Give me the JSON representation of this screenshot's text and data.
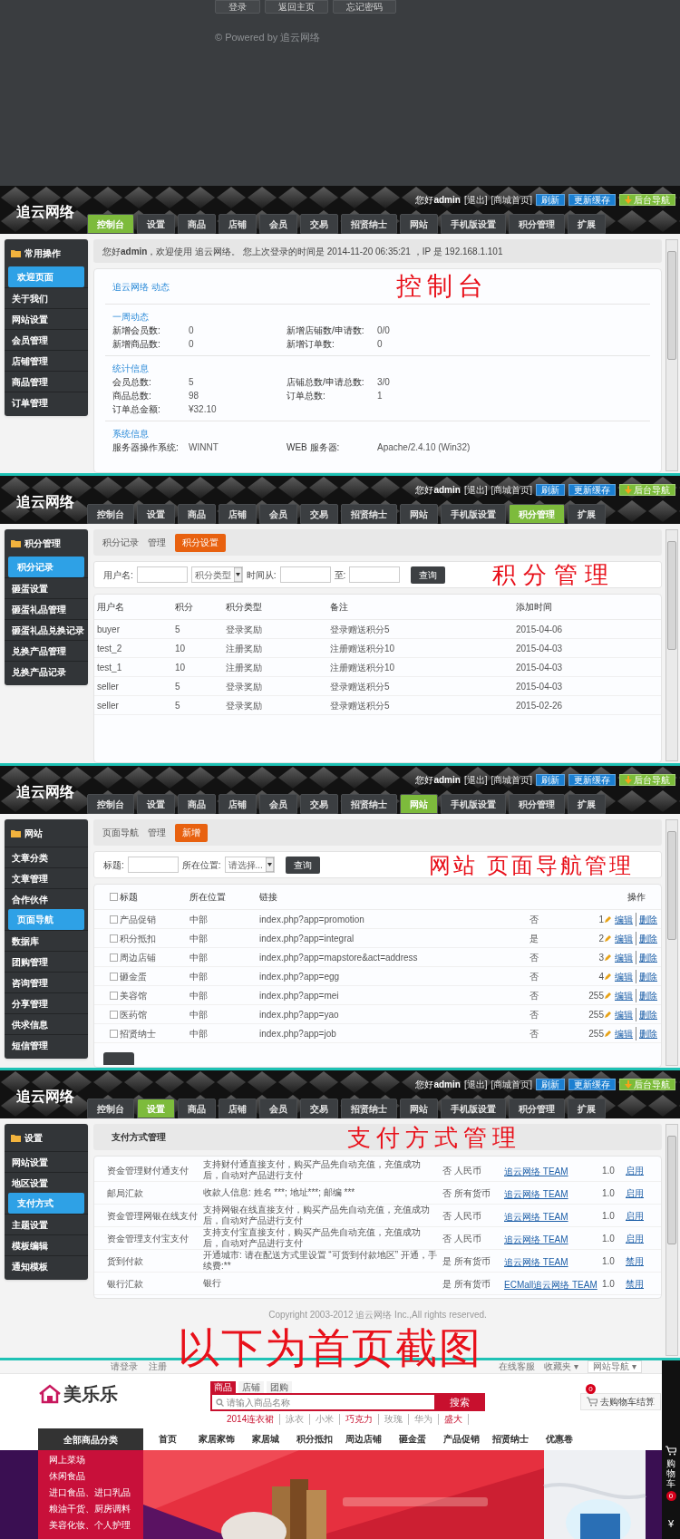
{
  "login_footer": {
    "buttons": [
      "登录",
      "返回主页",
      "忘记密码"
    ],
    "powered": "© Powered by 追云网络"
  },
  "panels": [
    {
      "kind": "dashboard",
      "annotation": "控制台",
      "header": {
        "logo": "追云网络",
        "greeting": "您好**admin**",
        "links": [
          "[退出]",
          "[商城首页]"
        ],
        "buttons": [
          {
            "label": "刷新",
            "color": "#1b7fd1"
          },
          {
            "label": "更新缓存",
            "color": "#1b7fd1"
          },
          {
            "label": "后台导航",
            "color": "#7cbc3a"
          }
        ]
      },
      "tabs": [
        {
          "label": "控制台",
          "selected": true
        },
        {
          "label": "设置",
          "selected": false
        },
        {
          "label": "商品",
          "selected": false
        },
        {
          "label": "店铺",
          "selected": false
        },
        {
          "label": "会员",
          "selected": false
        },
        {
          "label": "交易",
          "selected": false
        },
        {
          "label": "招贤纳士",
          "selected": false
        },
        {
          "label": "网站",
          "selected": false
        },
        {
          "label": "手机版设置",
          "selected": false
        },
        {
          "label": "积分管理",
          "selected": false
        },
        {
          "label": "扩展",
          "selected": false
        }
      ],
      "sidebar": {
        "title": "常用操作",
        "items": [
          {
            "label": "欢迎页面",
            "selected": true
          },
          {
            "label": "关于我们",
            "selected": false
          },
          {
            "label": "网站设置",
            "selected": false
          },
          {
            "label": "会员管理",
            "selected": false
          },
          {
            "label": "店铺管理",
            "selected": false
          },
          {
            "label": "商品管理",
            "selected": false
          },
          {
            "label": "订单管理",
            "selected": false
          }
        ]
      },
      "welcome": "您好**admin**，欢迎使用 追云网络。 您上次登录的时间是 2014-11-20 06:35:21 ，IP 是 192.168.1.101",
      "sections": [
        {
          "title": "追云网络 动态"
        },
        {
          "title": "一周动态",
          "rows": [
            [
              "新增会员数:",
              "0",
              "新增店铺数/申请数:",
              "0/0"
            ],
            [
              "新增商品数:",
              "0",
              "新增订单数:",
              "0"
            ]
          ]
        },
        {
          "title": "统计信息",
          "rows": [
            [
              "会员总数:",
              "5",
              "店铺总数/申请总数:",
              "3/0"
            ],
            [
              "商品总数:",
              "98",
              "订单总数:",
              "1"
            ],
            [
              "订单总金额:",
              "¥32.10"
            ]
          ]
        },
        {
          "title": "系统信息",
          "rows": [
            [
              "服务器操作系统:",
              "WINNT",
              "WEB 服务器:",
              "Apache/2.4.10 (Win32)"
            ]
          ]
        }
      ]
    },
    {
      "kind": "points",
      "annotation": "积分管理",
      "header": {
        "logo": "追云网络",
        "greeting": "您好**admin**",
        "links": [
          "[退出]",
          "[商城首页]"
        ],
        "buttons": [
          {
            "label": "刷新",
            "color": "#1b7fd1"
          },
          {
            "label": "更新缓存",
            "color": "#1b7fd1"
          },
          {
            "label": "后台导航",
            "color": "#7cbc3a"
          }
        ]
      },
      "tabs": [
        {
          "label": "控制台",
          "selected": false
        },
        {
          "label": "设置",
          "selected": false
        },
        {
          "label": "商品",
          "selected": false
        },
        {
          "label": "店铺",
          "selected": false
        },
        {
          "label": "会员",
          "selected": false
        },
        {
          "label": "交易",
          "selected": false
        },
        {
          "label": "招贤纳士",
          "selected": false
        },
        {
          "label": "网站",
          "selected": false
        },
        {
          "label": "手机版设置",
          "selected": false
        },
        {
          "label": "积分管理",
          "selected": true
        },
        {
          "label": "扩展",
          "selected": false
        }
      ],
      "sidebar": {
        "title": "积分管理",
        "items": [
          {
            "label": "积分记录",
            "selected": true
          },
          {
            "label": "砸蛋设置",
            "selected": false
          },
          {
            "label": "砸蛋礼品管理",
            "selected": false
          },
          {
            "label": "砸蛋礼品兑换记录",
            "selected": false
          },
          {
            "label": "兑换产品管理",
            "selected": false
          },
          {
            "label": "兑换产品记录",
            "selected": false
          }
        ]
      },
      "crumbs": [
        "积分记录",
        "管理"
      ],
      "action_button": "积分设置",
      "filters": [
        {
          "kind": "input",
          "label": "用户名:"
        },
        {
          "kind": "select",
          "value": "积分类型"
        },
        {
          "kind": "input",
          "label": "时间从:"
        },
        {
          "kind": "input",
          "label": "至:"
        }
      ],
      "search_button": "查询",
      "table": {
        "columns": [
          "用户名",
          "积分",
          "积分类型",
          "备注",
          "添加时间"
        ],
        "rows": [
          [
            "buyer",
            "5",
            "登录奖励",
            "登录赠送积分5",
            "2015-04-06"
          ],
          [
            "test_2",
            "10",
            "注册奖励",
            "注册赠送积分10",
            "2015-04-03"
          ],
          [
            "test_1",
            "10",
            "注册奖励",
            "注册赠送积分10",
            "2015-04-03"
          ],
          [
            "seller",
            "5",
            "登录奖励",
            "登录赠送积分5",
            "2015-04-03"
          ],
          [
            "seller",
            "5",
            "登录奖励",
            "登录赠送积分5",
            "2015-02-26"
          ]
        ]
      }
    },
    {
      "kind": "nav",
      "annotation": "网站 页面导航管理",
      "header": {
        "logo": "追云网络",
        "greeting": "您好**admin**",
        "links": [
          "[退出]",
          "[商城首页]"
        ],
        "buttons": [
          {
            "label": "刷新",
            "color": "#1b7fd1"
          },
          {
            "label": "更新缓存",
            "color": "#1b7fd1"
          },
          {
            "label": "后台导航",
            "color": "#7cbc3a"
          }
        ]
      },
      "tabs": [
        {
          "label": "控制台",
          "selected": false
        },
        {
          "label": "设置",
          "selected": false
        },
        {
          "label": "商品",
          "selected": false
        },
        {
          "label": "店铺",
          "selected": false
        },
        {
          "label": "会员",
          "selected": false
        },
        {
          "label": "交易",
          "selected": false
        },
        {
          "label": "招贤纳士",
          "selected": false
        },
        {
          "label": "网站",
          "selected": true
        },
        {
          "label": "手机版设置",
          "selected": false
        },
        {
          "label": "积分管理",
          "selected": false
        },
        {
          "label": "扩展",
          "selected": false
        }
      ],
      "sidebar": {
        "title": "网站",
        "items": [
          {
            "label": "文章分类",
            "selected": false
          },
          {
            "label": "文章管理",
            "selected": false
          },
          {
            "label": "合作伙伴",
            "selected": false
          },
          {
            "label": "页面导航",
            "selected": true
          },
          {
            "label": "数据库",
            "selected": false
          },
          {
            "label": "团购管理",
            "selected": false
          },
          {
            "label": "咨询管理",
            "selected": false
          },
          {
            "label": "分享管理",
            "selected": false
          },
          {
            "label": "供求信息",
            "selected": false
          },
          {
            "label": "短信管理",
            "selected": false
          }
        ]
      },
      "crumbs": [
        "页面导航",
        "管理"
      ],
      "action_button": "新增",
      "filters": [
        {
          "kind": "input",
          "label": "标题:"
        },
        {
          "kind": "select",
          "label": "所在位置:",
          "value": "请选择..."
        }
      ],
      "search_button": "查询",
      "table": {
        "header_checked": false,
        "columns": [
          "标题",
          "所在位置",
          "链接",
          "操作"
        ],
        "rows": [
          {
            "checked": false,
            "title": "产品促销",
            "position": "中部",
            "link": "index.php?app=promotion",
            "new_window": "否",
            "sort": "1",
            "actions": [
              "编辑",
              "删除"
            ]
          },
          {
            "checked": false,
            "title": "积分抵扣",
            "position": "中部",
            "link": "index.php?app=integral",
            "new_window": "是",
            "sort": "2",
            "actions": [
              "编辑",
              "删除"
            ]
          },
          {
            "checked": false,
            "title": "周边店铺",
            "position": "中部",
            "link": "index.php?app=mapstore&act=address",
            "new_window": "否",
            "sort": "3",
            "actions": [
              "编辑",
              "删除"
            ]
          },
          {
            "checked": false,
            "title": "砸金蛋",
            "position": "中部",
            "link": "index.php?app=egg",
            "new_window": "否",
            "sort": "4",
            "actions": [
              "编辑",
              "删除"
            ]
          },
          {
            "checked": false,
            "title": "美容馆",
            "position": "中部",
            "link": "index.php?app=mei",
            "new_window": "否",
            "sort": "255",
            "actions": [
              "编辑",
              "删除"
            ]
          },
          {
            "checked": false,
            "title": "医药馆",
            "position": "中部",
            "link": "index.php?app=yao",
            "new_window": "否",
            "sort": "255",
            "actions": [
              "编辑",
              "删除"
            ]
          },
          {
            "checked": false,
            "title": "招贤纳士",
            "position": "中部",
            "link": "index.php?app=job",
            "new_window": "否",
            "sort": "255",
            "actions": [
              "编辑",
              "删除"
            ]
          }
        ]
      }
    },
    {
      "kind": "payment",
      "annotation": "支付方式管理",
      "header": {
        "logo": "追云网络",
        "greeting": "您好**admin**",
        "links": [
          "[退出]",
          "[商城首页]"
        ],
        "buttons": [
          {
            "label": "刷新",
            "color": "#1b7fd1"
          },
          {
            "label": "更新缓存",
            "color": "#1b7fd1"
          },
          {
            "label": "后台导航",
            "color": "#7cbc3a"
          }
        ]
      },
      "tabs": [
        {
          "label": "控制台",
          "selected": false
        },
        {
          "label": "设置",
          "selected": true
        },
        {
          "label": "商品",
          "selected": false
        },
        {
          "label": "店铺",
          "selected": false
        },
        {
          "label": "会员",
          "selected": false
        },
        {
          "label": "交易",
          "selected": false
        },
        {
          "label": "招贤纳士",
          "selected": false
        },
        {
          "label": "网站",
          "selected": false
        },
        {
          "label": "手机版设置",
          "selected": false
        },
        {
          "label": "积分管理",
          "selected": false
        },
        {
          "label": "扩展",
          "selected": false
        }
      ],
      "sidebar": {
        "title": "设置",
        "items": [
          {
            "label": "网站设置",
            "selected": false
          },
          {
            "label": "地区设置",
            "selected": false
          },
          {
            "label": "支付方式",
            "selected": true
          },
          {
            "label": "主题设置",
            "selected": false
          },
          {
            "label": "模板编辑",
            "selected": false
          },
          {
            "label": "通知模板",
            "selected": false
          }
        ]
      },
      "title": "支付方式管理",
      "rows": [
        {
          "name": "资金管理财付通支付",
          "description": "支持财付通直接支付，购买产品先自动充值，充值成功后，自动对产品进行支付",
          "online": "否",
          "currency": "人民币",
          "author": "追云网络 TEAM",
          "version": "1.0",
          "action": "启用"
        },
        {
          "name": "邮局汇款",
          "description": "收款人信息: 姓名 ***; 地址***; 邮编 ***",
          "online": "否",
          "currency": "所有货币",
          "author": "追云网络 TEAM",
          "version": "1.0",
          "action": "启用"
        },
        {
          "name": "资金管理网银在线支付",
          "description": "支持网银在线直接支付，购买产品先自动充值，充值成功后，自动对产品进行支付",
          "online": "否",
          "currency": "人民币",
          "author": "追云网络 TEAM",
          "version": "1.0",
          "action": "启用"
        },
        {
          "name": "资金管理支付宝支付",
          "description": "支持支付宝直接支付，购买产品先自动充值，充值成功后，自动对产品进行支付",
          "online": "否",
          "currency": "人民币",
          "author": "追云网络 TEAM",
          "version": "1.0",
          "action": "启用"
        },
        {
          "name": "货到付款",
          "description": "开通城市: 请在配送方式里设置 “可货到付款地区” 开通，手续费:**",
          "online": "是",
          "currency": "所有货币",
          "author": "追云网络 TEAM",
          "version": "1.0",
          "action": "禁用"
        },
        {
          "name": "银行汇款",
          "description": "银行",
          "online": "是",
          "currency": "所有货币",
          "author": "ECMall追云网络 TEAM",
          "version": "1.0",
          "action": "禁用"
        }
      ],
      "copyright": "Copyright 2003-2012 追云网络 Inc.,All rights reserved."
    }
  ],
  "page_annotation": "以下为首页截图",
  "store": {
    "top_links_left": [
      "请登录",
      "注册"
    ],
    "top_links_right": [
      "在线客服",
      "收藏夹 ▾",
      "网站导航 ▾"
    ],
    "logo": "美乐乐",
    "search_tabs": [
      {
        "label": "商品",
        "selected": true
      },
      {
        "label": "店铺",
        "selected": false
      },
      {
        "label": "团购",
        "selected": false
      }
    ],
    "search_placeholder": "请输入商品名称",
    "search_button": "搜索",
    "hot_words": [
      {
        "label": "2014连衣裙",
        "hot": true
      },
      {
        "label": "泳衣",
        "hot": false
      },
      {
        "label": "小米",
        "hot": false
      },
      {
        "label": "巧克力",
        "hot": true
      },
      {
        "label": "玫瑰",
        "hot": false
      },
      {
        "label": "华为",
        "hot": false
      },
      {
        "label": "盛大",
        "hot": true
      }
    ],
    "cart": {
      "label": "去购物车结算",
      "count": "0"
    },
    "all_categories": "全部商品分类",
    "nav": [
      "首页",
      "家居家饰",
      "家居城",
      "积分抵扣",
      "周边店铺",
      "砸金蛋",
      "产品促销",
      "招贤纳士",
      "优惠卷"
    ],
    "categories": [
      "网上菜场",
      "休闲食品",
      "进口食品、进口乳品",
      "粮油干货、厨房调料",
      "美容化妆、个人护理"
    ],
    "side_cart": {
      "label": "购物车",
      "count": "0",
      "currency": "¥"
    }
  }
}
